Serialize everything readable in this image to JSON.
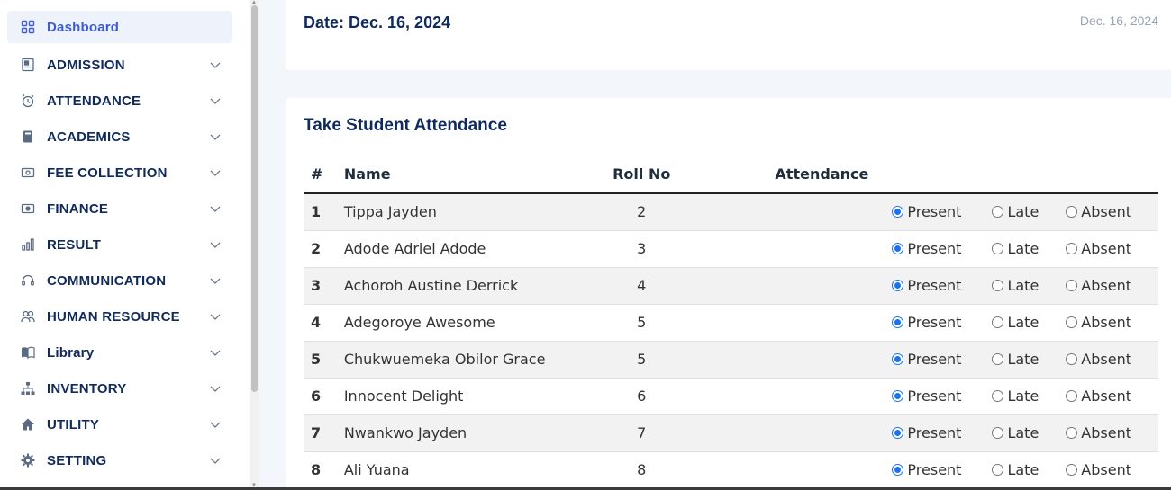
{
  "sidebar": {
    "items": [
      {
        "label": "Dashboard",
        "icon": "grid-icon",
        "active": true,
        "expandable": false
      },
      {
        "label": "ADMISSION",
        "icon": "admission-icon",
        "expandable": true
      },
      {
        "label": "ATTENDANCE",
        "icon": "alarm-clock-icon",
        "expandable": true
      },
      {
        "label": "ACADEMICS",
        "icon": "book-icon",
        "expandable": true
      },
      {
        "label": "FEE COLLECTION",
        "icon": "cash-icon",
        "expandable": true
      },
      {
        "label": "FINANCE",
        "icon": "money-icon",
        "expandable": true
      },
      {
        "label": "RESULT",
        "icon": "bar-chart-icon",
        "expandable": true
      },
      {
        "label": "COMMUNICATION",
        "icon": "headset-icon",
        "expandable": true
      },
      {
        "label": "HUMAN RESOURCE",
        "icon": "users-icon",
        "expandable": true
      },
      {
        "label": "Library",
        "icon": "open-book-icon",
        "expandable": true
      },
      {
        "label": "INVENTORY",
        "icon": "hierarchy-icon",
        "expandable": true
      },
      {
        "label": "UTILITY",
        "icon": "home-icon",
        "expandable": true
      },
      {
        "label": "SETTING",
        "icon": "gear-icon",
        "expandable": true
      }
    ]
  },
  "header": {
    "date_title": "Date: Dec. 16, 2024",
    "date_right": "Dec. 16, 2024"
  },
  "attendance": {
    "title": "Take Student Attendance",
    "columns": [
      "#",
      "Name",
      "Roll No",
      "Attendance"
    ],
    "options": [
      "Present",
      "Late",
      "Absent"
    ],
    "rows": [
      {
        "num": "1",
        "name": "Tippa Jayden",
        "roll": "2",
        "status": "Present"
      },
      {
        "num": "2",
        "name": "Adode Adriel Adode",
        "roll": "3",
        "status": "Present"
      },
      {
        "num": "3",
        "name": "Achoroh Austine Derrick",
        "roll": "4",
        "status": "Present"
      },
      {
        "num": "4",
        "name": "Adegoroye Awesome",
        "roll": "5",
        "status": "Present"
      },
      {
        "num": "5",
        "name": "Chukwuemeka Obilor Grace",
        "roll": "5",
        "status": "Present"
      },
      {
        "num": "6",
        "name": "Innocent Delight",
        "roll": "6",
        "status": "Present"
      },
      {
        "num": "7",
        "name": "Nwankwo Jayden",
        "roll": "7",
        "status": "Present"
      },
      {
        "num": "8",
        "name": "Ali Yuana",
        "roll": "8",
        "status": "Present"
      }
    ]
  },
  "colors": {
    "nav_text": "#0f2a5c",
    "active_text": "#3d5bd9",
    "active_bg": "#eef2fb",
    "radio_on": "#1a73e8",
    "page_bg": "#f3f6fb"
  }
}
